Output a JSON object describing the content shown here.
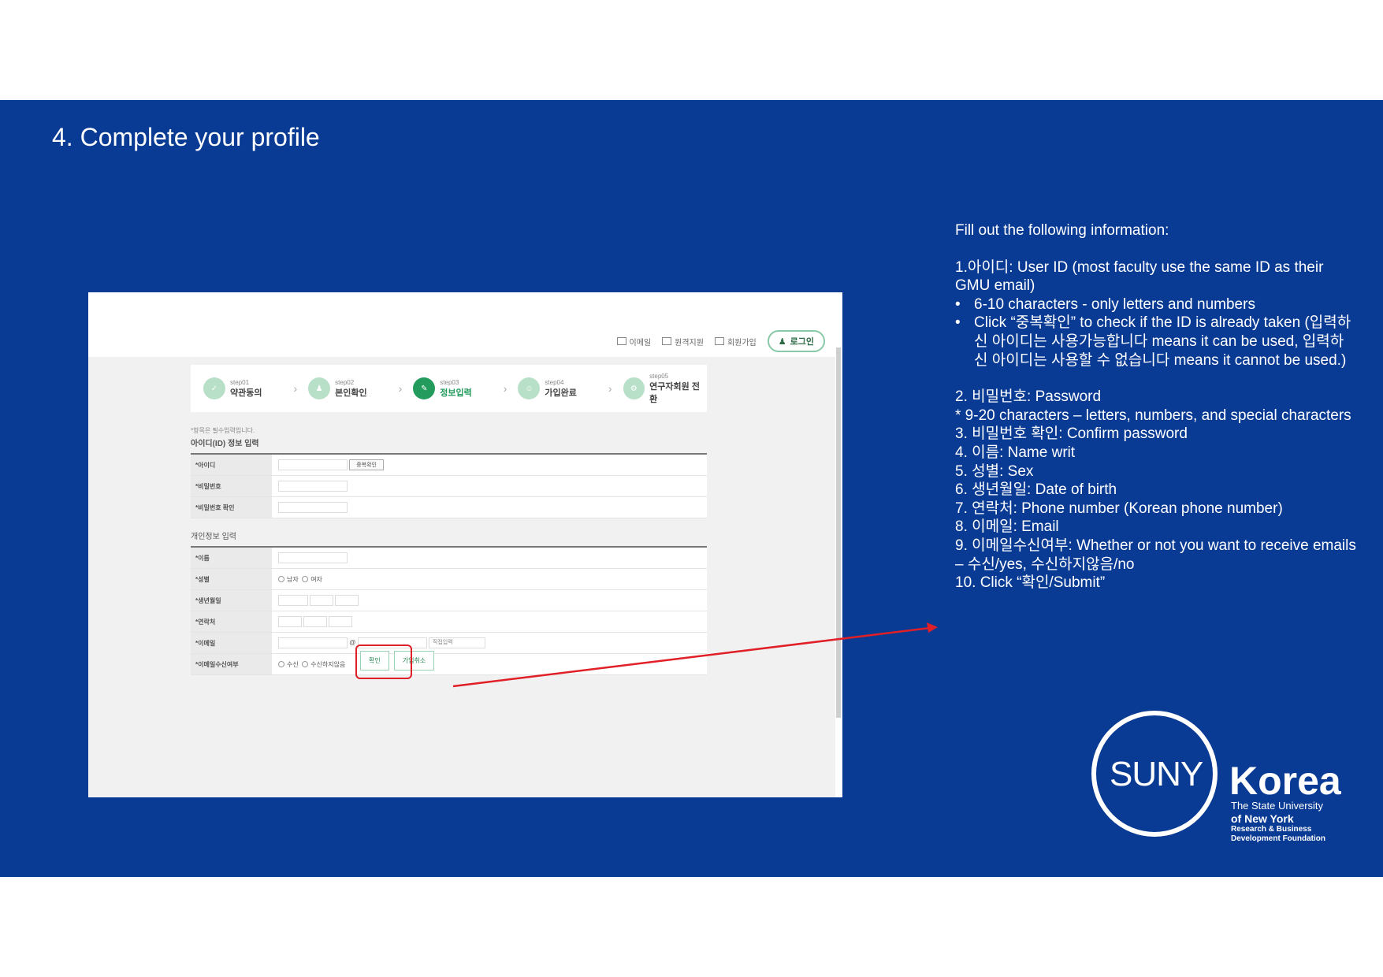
{
  "slide": {
    "title": "4. Complete your profile"
  },
  "screenshot": {
    "topnav": {
      "links": [
        "이메일",
        "원격지원",
        "회원가입"
      ],
      "login": "로그인"
    },
    "steps": [
      {
        "num": "step01",
        "label": "약관동의"
      },
      {
        "num": "step02",
        "label": "본인확인"
      },
      {
        "num": "step03",
        "label": "정보입력"
      },
      {
        "num": "step04",
        "label": "가입완료"
      },
      {
        "num": "step05",
        "label": "연구자회원 전환"
      }
    ],
    "required_note": "*항목은 필수입력입니다.",
    "section_id": "아이디(ID) 정보 입력",
    "section_personal": "개인정보 입력",
    "fields": {
      "id": "*아이디",
      "password": "*비밀번호",
      "password_confirm": "*비밀번호 확인",
      "name": "*이름",
      "sex": "*성별",
      "birth": "*생년월일",
      "phone": "*연락처",
      "email": "*이메일",
      "email_consent": "*이메일수신여부"
    },
    "dup_check_button": "중복확인",
    "male": "남자",
    "female": "여자",
    "email_domain_select": "직접입력",
    "receive": "수신",
    "not_receive": "수신하지않음",
    "confirm_button": "확인",
    "cancel_button": "가입취소"
  },
  "instructions": {
    "intro": "Fill out the following information:",
    "item1": "1.아이디: User ID (most faculty use the same ID as their GMU email)",
    "item1_bullets": [
      "6-10 characters - only letters and numbers",
      "Click “중복확인” to check if the ID is already taken (입력하신 아이디는 사용가능합니다 means it can be used, 입력하신 아이디는 사용할 수 없습니다 means it cannot be used.)"
    ],
    "item2": "2. 비밀번호: Password",
    "item2_note": "* 9-20 characters – letters, numbers, and special characters",
    "item3": "3. 비밀번호 확인: Confirm password",
    "item4": "4. 이름: Name writ",
    "item5": "5. 성별: Sex",
    "item6": "6. 생년월일: Date of birth",
    "item7": "7. 연락처: Phone number (Korean phone number)",
    "item8": "8. 이메일: Email",
    "item9": "9. 이메일수신여부: Whether or not you want to receive emails – 수신/yes, 수신하지않음/no",
    "item10": "10. Click “확인/Submit”"
  },
  "logo": {
    "suny": "SUNY",
    "korea": "Korea",
    "line1": "The State University",
    "line2": "of New York",
    "line3": "Research & Business Development Foundation"
  },
  "colors": {
    "slide_bg": "#093b94",
    "accent_green": "#229b5c",
    "highlight_red": "#e01f26"
  }
}
